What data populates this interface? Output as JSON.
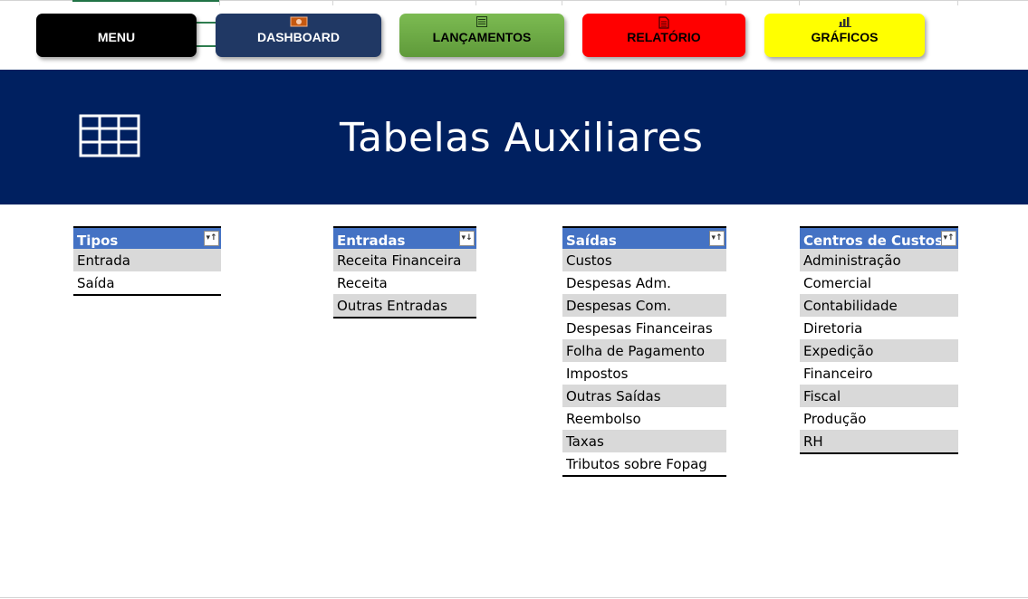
{
  "nav": {
    "menu_label": "MENU",
    "dashboard_label": "DASHBOARD",
    "lancamentos_label": "LANÇAMENTOS",
    "relatorio_label": "RELATÓRIO",
    "graficos_label": "GRÁFICOS",
    "dashboard_icon": "money-icon",
    "lancamentos_icon": "list-icon",
    "relatorio_icon": "document-icon",
    "graficos_icon": "bar-chart-icon"
  },
  "banner": {
    "title": "Tabelas Auxiliares",
    "icon": "table-icon",
    "background": "#002060"
  },
  "tables": {
    "tipos": {
      "header": "Tipos",
      "rows": [
        "Entrada",
        "Saída"
      ]
    },
    "entradas": {
      "header": "Entradas",
      "rows": [
        "Receita Financeira",
        "Receita",
        "Outras Entradas"
      ]
    },
    "saidas": {
      "header": "Saídas",
      "rows": [
        "Custos",
        "Despesas Adm.",
        "Despesas Com.",
        "Despesas Financeiras",
        "Folha de Pagamento",
        "Impostos",
        "Outras Saídas",
        "Reembolso",
        "Taxas",
        "Tributos sobre Fopag"
      ]
    },
    "centros": {
      "header": "Centros de Custos",
      "rows": [
        "Administração",
        "Comercial",
        "Contabilidade",
        "Diretoria",
        "Expedição",
        "Financeiro",
        "Fiscal",
        "Produção",
        "RH"
      ]
    }
  },
  "colors": {
    "table_header": "#4472c4",
    "band": "#d9d9d9",
    "menu": "#000000",
    "dashboard": "#203864",
    "lancamentos": "#70ad47",
    "relatorio": "#ff0000",
    "graficos": "#ffff00"
  }
}
